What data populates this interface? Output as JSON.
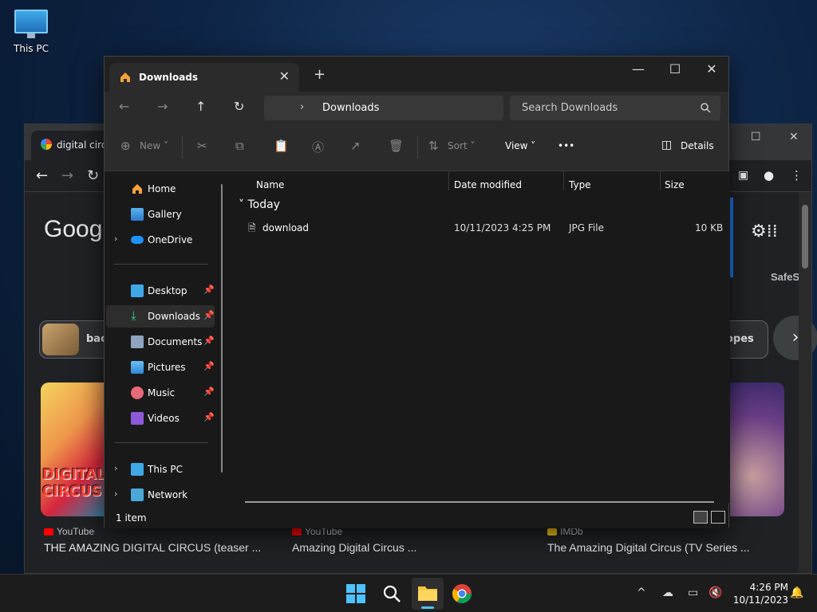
{
  "desktop": {
    "icon_label": "This PC"
  },
  "chrome": {
    "tab_title": "digital circ",
    "google_logo": "Googl",
    "safesearch": "SafeS",
    "chip1": "bac",
    "chip2": "opes",
    "img1_text": "DIGITAL CIRCUS",
    "results": [
      {
        "source": "YouTube",
        "title": "THE AMAZING DIGITAL CIRCUS (teaser ..."
      },
      {
        "source": "YouTube",
        "title": "Amazing Digital Circus ..."
      },
      {
        "source": "IMDb",
        "title": "The Amazing Digital Circus (TV Series ..."
      }
    ]
  },
  "explorer": {
    "tab_title": "Downloads",
    "new_tab": "+",
    "address": "Downloads",
    "search_placeholder": "Search Downloads",
    "toolbar": {
      "new": "New",
      "sort": "Sort",
      "view": "View",
      "details": "Details",
      "more": "•••"
    },
    "nav": {
      "home": "Home",
      "gallery": "Gallery",
      "onedrive": "OneDrive",
      "desktop": "Desktop",
      "downloads": "Downloads",
      "documents": "Documents",
      "pictures": "Pictures",
      "music": "Music",
      "videos": "Videos",
      "thispc": "This PC",
      "network": "Network"
    },
    "columns": {
      "name": "Name",
      "date": "Date modified",
      "type": "Type",
      "size": "Size"
    },
    "group": "Today",
    "files": [
      {
        "name": "download",
        "date": "10/11/2023 4:25 PM",
        "type": "JPG File",
        "size": "10 KB"
      }
    ],
    "status": "1 item"
  },
  "taskbar": {
    "time": "4:26 PM",
    "date": "10/11/2023"
  }
}
